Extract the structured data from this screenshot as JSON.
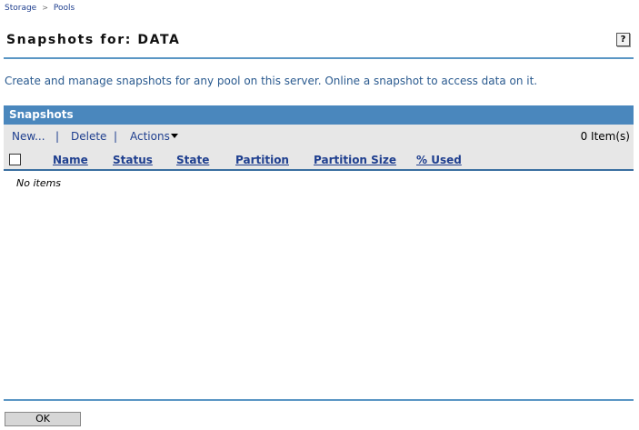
{
  "breadcrumb": {
    "storage": "Storage",
    "separator": ">",
    "pools": "Pools"
  },
  "page": {
    "title": "Snapshots for: DATA",
    "help_label": "?",
    "description": "Create and manage snapshots for any pool on this server. Online a snapshot to access data on it."
  },
  "panel": {
    "title": "Snapshots",
    "toolbar": {
      "new_label": "New...",
      "delete_label": "Delete",
      "actions_label": "Actions",
      "separator": "|",
      "item_count": "0 Item(s)"
    },
    "columns": [
      "Name",
      "Status",
      "State",
      "Partition",
      "Partition Size",
      "% Used"
    ],
    "empty_text": "No items"
  },
  "footer": {
    "ok_label": "OK"
  },
  "colors": {
    "accent": "#4a87bd",
    "rule": "#5a96c4",
    "link": "#1f3f8f",
    "toolbar_bg": "#e7e7e7"
  }
}
